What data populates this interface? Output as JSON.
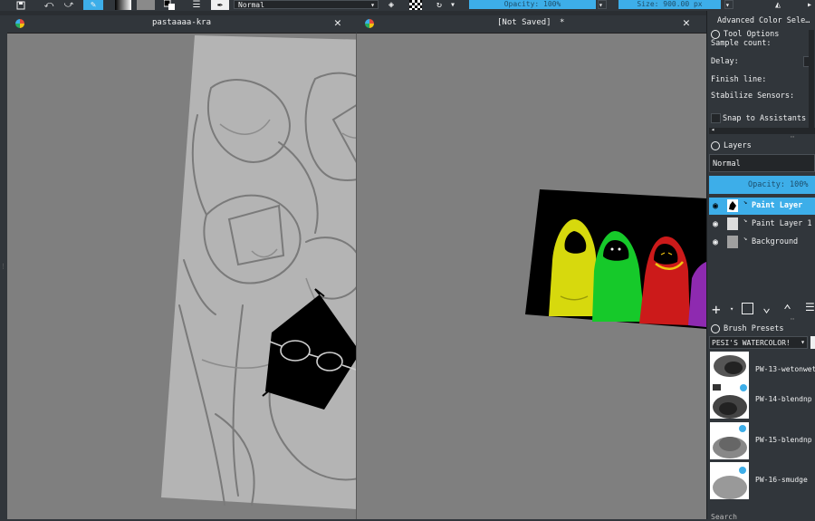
{
  "toolbar": {
    "blend_mode": "Normal",
    "opacity_label": "Opacity: 100%",
    "size_label": "Size: 900.00 px",
    "close_glyph": "✕"
  },
  "tabs": [
    {
      "title": "pastaaaa-kra",
      "close": "✕"
    },
    {
      "title": "[Not Saved]",
      "modified": "*",
      "close": "✕"
    }
  ],
  "dock": {
    "advanced_color_title": "Advanced Color Sele…",
    "tool_options": {
      "title": "Tool Options",
      "sample_count": "Sample count:",
      "delay": "Delay:",
      "finish_line": "Finish line:",
      "stabilize_sensors": "Stabilize Sensors:",
      "snap_assistants": "Snap to Assistants"
    },
    "layers": {
      "title": "Layers",
      "blend_mode": "Normal",
      "opacity_label": "Opacity:  100%",
      "items": [
        {
          "name": "Paint Layer",
          "selected": true
        },
        {
          "name": "Paint Layer 1",
          "selected": false
        },
        {
          "name": "Background",
          "selected": false
        }
      ]
    },
    "brush_presets": {
      "title": "Brush Presets",
      "tag": "PESI'S WATERCOLOR!",
      "items": [
        {
          "name": "PW-13-wetonwet"
        },
        {
          "name": "PW-14-blendnp"
        },
        {
          "name": "PW-15-blendnp"
        },
        {
          "name": "PW-16-smudge"
        }
      ],
      "search_label": "Search"
    }
  },
  "colors": {
    "accent": "#3daee9",
    "panel_bg": "#31363b",
    "canvas_bg": "#7f7f7f",
    "paper": "#b4b4b4"
  }
}
